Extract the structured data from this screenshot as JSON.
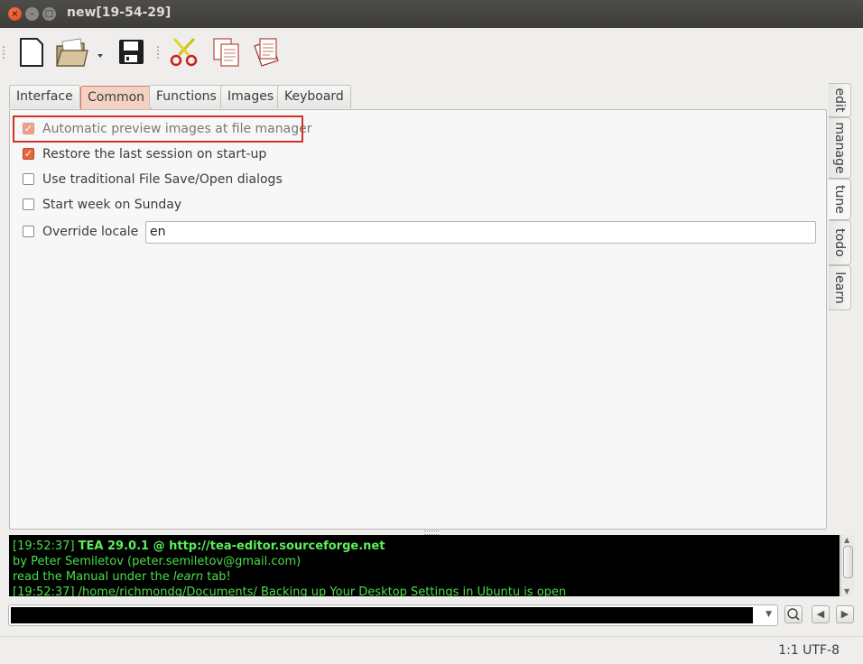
{
  "window": {
    "title": "new[19-54-29]"
  },
  "toolbar": {
    "icons": [
      "new-file-icon",
      "open-folder-icon",
      "save-icon",
      "cut-icon",
      "copy-icon",
      "paste-icon"
    ]
  },
  "tabs": [
    {
      "label": "Interface",
      "active": false
    },
    {
      "label": "Common",
      "active": true
    },
    {
      "label": "Functions",
      "active": false
    },
    {
      "label": "Images",
      "active": false
    },
    {
      "label": "Keyboard",
      "active": false
    }
  ],
  "options": {
    "auto_preview": {
      "label": "Automatic preview images at file manager",
      "checked": true
    },
    "restore_session": {
      "label": "Restore the last session on start-up",
      "checked": true
    },
    "traditional_dialogs": {
      "label": "Use traditional File Save/Open dialogs",
      "checked": false
    },
    "week_sunday": {
      "label": "Start week on Sunday",
      "checked": false
    },
    "override_locale": {
      "label": "Override locale",
      "checked": false,
      "value": "en"
    }
  },
  "side_tabs": [
    {
      "label": "edit",
      "active": false
    },
    {
      "label": "manage",
      "active": false
    },
    {
      "label": "tune",
      "active": true
    },
    {
      "label": "todo",
      "active": false
    },
    {
      "label": "learn",
      "active": false
    }
  ],
  "log": {
    "line1_ts": "[19:52:37]",
    "line1_bold": "TEA 29.0.1 @ http://tea-editor.sourceforge.net",
    "line2": "by Peter Semiletov (peter.semiletov@gmail.com)",
    "line3_pre": "read the Manual under the ",
    "line3_em": "learn",
    "line3_post": " tab!",
    "line4": "[19:52:37] /home/richmondg/Documents/ Backing up Your Desktop Settings in Ubuntu is open"
  },
  "status": {
    "text": "1:1 UTF-8"
  },
  "colors": {
    "accent": "#e8643c",
    "highlight_box": "#d0322a",
    "log_text": "#4ade4a"
  }
}
